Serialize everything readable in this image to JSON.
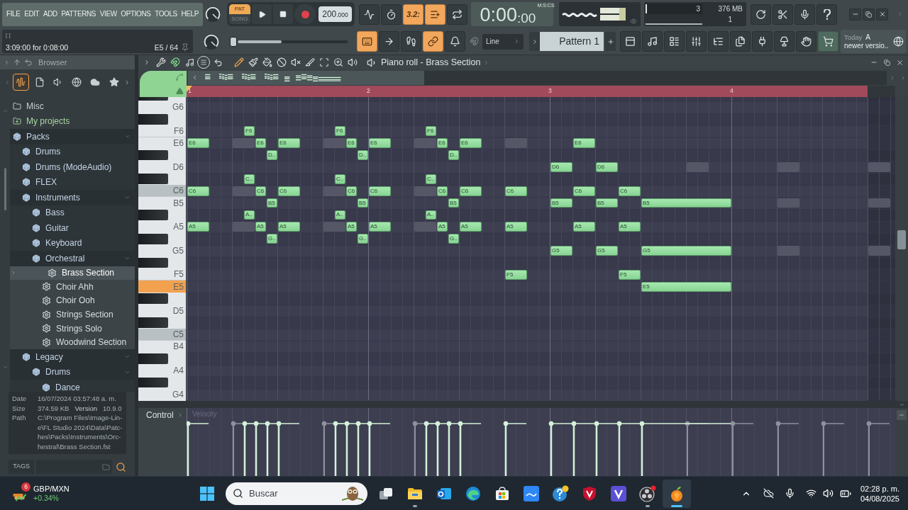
{
  "menu": {
    "items": [
      "FILE",
      "EDIT",
      "ADD",
      "PATTERNS",
      "VIEW",
      "OPTIONS",
      "TOOLS",
      "HELP"
    ]
  },
  "hint": {
    "title": "[ ]",
    "text": "3:09:00 for 0:08:00",
    "note": "E5 / 64"
  },
  "transport": {
    "modes": [
      {
        "label": "PAT",
        "selected": true
      },
      {
        "label": "SONG",
        "selected": false
      }
    ],
    "tempo_whole": "200",
    "tempo_fraction": ".000",
    "position": {
      "level": 0
    }
  },
  "record_toggles": [
    {
      "on": false
    },
    {
      "on": false
    },
    {
      "label": "3.2:",
      "on": true
    },
    {
      "on": true
    },
    {
      "on": false
    }
  ],
  "edit_toggles": [
    {
      "on": true
    },
    {
      "on": false
    },
    {
      "on": false
    },
    {
      "on": true
    },
    {
      "on": false
    }
  ],
  "time": {
    "main": "0:00",
    "fraction": ":00",
    "unit": "M:S:CS"
  },
  "meters": {
    "cpu": {
      "level": 0.03
    },
    "top_value": "3",
    "memory": "376 MB",
    "bottom_value": "1"
  },
  "snap": {
    "value": "Line"
  },
  "pattern": {
    "name": "Pattern 1"
  },
  "news": {
    "date": "Today",
    "lines": [
      "A",
      "newer versio.."
    ]
  },
  "browser": {
    "title": "Browser",
    "tabs": [
      {
        "selected": true
      },
      {
        "selected": false
      },
      {
        "selected": false
      },
      {
        "selected": false
      },
      {
        "selected": false
      },
      {
        "selected": false
      }
    ],
    "tree": [
      {
        "label": "Misc",
        "kind": "folder",
        "expanded": false,
        "selected": false
      },
      {
        "label": "My projects",
        "kind": "projects",
        "expanded": false,
        "selected": false
      },
      {
        "label": "Packs",
        "kind": "pack",
        "expanded": true,
        "selected": false,
        "children": [
          {
            "label": "Drums",
            "kind": "pack",
            "expanded": false,
            "selected": false
          },
          {
            "label": "Drums (ModeAudio)",
            "kind": "pack",
            "expanded": false,
            "selected": false
          },
          {
            "label": "FLEX",
            "kind": "pack",
            "expanded": false,
            "selected": false
          },
          {
            "label": "Instruments",
            "kind": "pack",
            "expanded": true,
            "selected": false,
            "children": [
              {
                "label": "Bass",
                "kind": "pack",
                "expanded": false,
                "selected": false
              },
              {
                "label": "Guitar",
                "kind": "pack",
                "expanded": false,
                "selected": false
              },
              {
                "label": "Keyboard",
                "kind": "pack",
                "expanded": false,
                "selected": false
              },
              {
                "label": "Orchestral",
                "kind": "pack",
                "expanded": true,
                "selected": false,
                "children": [
                  {
                    "label": "Brass Section",
                    "kind": "preset",
                    "selected": true
                  },
                  {
                    "label": "Choir Ahh",
                    "kind": "preset",
                    "selected": false
                  },
                  {
                    "label": "Choir Ooh",
                    "kind": "preset",
                    "selected": false
                  },
                  {
                    "label": "Strings Section",
                    "kind": "preset",
                    "selected": false
                  },
                  {
                    "label": "Strings Solo",
                    "kind": "preset",
                    "selected": false
                  },
                  {
                    "label": "Woodwind Section",
                    "kind": "preset",
                    "selected": false
                  }
                ]
              }
            ]
          },
          {
            "label": "Legacy",
            "kind": "pack",
            "expanded": true,
            "selected": false,
            "children": [
              {
                "label": "Drums",
                "kind": "pack",
                "expanded": true,
                "selected": false,
                "children": [
                  {
                    "label": "Dance",
                    "kind": "pack",
                    "expanded": false,
                    "selected": false
                  }
                ]
              }
            ]
          }
        ]
      }
    ],
    "info": {
      "date_label": "Date",
      "date": "16/07/2024 03:57:48 a. m.",
      "size_label": "Size",
      "size": "374.59 KB",
      "version_label": "Version",
      "version": "10.9.0",
      "path_label": "Path",
      "path_lines": [
        "C:\\Program Files\\Image-Lin-",
        "e\\FL Studio 2024\\Data\\Patc-",
        "hes\\Packs\\Instruments\\Orc-",
        "hestral\\Brass Section.fst"
      ]
    },
    "tags": {
      "label": "TAGS"
    }
  },
  "piano_roll": {
    "title": "Piano roll - Brass Section",
    "snap": true,
    "tools": [
      {
        "selected": true
      },
      {
        "selected": false
      },
      {
        "selected": false
      },
      {
        "selected": false
      },
      {
        "selected": false
      },
      {
        "selected": false
      },
      {
        "selected": false
      },
      {
        "selected": false
      },
      {
        "selected": false
      }
    ],
    "bars": [
      "1",
      "2",
      "3",
      "4"
    ],
    "rows": [
      {
        "kind": "sharp",
        "selected": false
      },
      {
        "kind": "natural",
        "label": "G6",
        "selected": false
      },
      {
        "kind": "sharp",
        "selected": false
      },
      {
        "kind": "natural",
        "label": "F6",
        "selected": false,
        "notes": [
          "F6",
          "F6",
          "F6"
        ]
      },
      {
        "kind": "natural",
        "label": "E6",
        "selected": false,
        "notes": [
          "E6",
          "E6",
          "E6",
          "E6",
          "E6",
          "E6",
          "E6",
          "E6"
        ]
      },
      {
        "kind": "sharp",
        "selected": false,
        "notes": [
          "D..",
          "D..",
          "D.."
        ]
      },
      {
        "kind": "natural",
        "label": "D6",
        "selected": false,
        "notes": [
          "D6",
          "D6"
        ]
      },
      {
        "kind": "sharp",
        "selected": false,
        "notes": [
          "C..",
          "C..",
          "C.."
        ]
      },
      {
        "kind": "c",
        "label": "C6",
        "selected": false,
        "notes": [
          "C6",
          "C6",
          "C6",
          "C6",
          "C6",
          "C6",
          "C6",
          "C6",
          "C6",
          "C6"
        ]
      },
      {
        "kind": "natural",
        "label": "B5",
        "selected": false,
        "notes": [
          "B5",
          "B5",
          "B5",
          "B5",
          "B5",
          "B5"
        ]
      },
      {
        "kind": "sharp",
        "selected": false,
        "notes": [
          "A..",
          "A..",
          "A.."
        ]
      },
      {
        "kind": "natural",
        "label": "A5",
        "selected": false,
        "notes": [
          "A5",
          "A5",
          "A5",
          "A5",
          "A5",
          "A5",
          "A5",
          "A5",
          "A5",
          "A5"
        ]
      },
      {
        "kind": "sharp",
        "selected": false,
        "notes": [
          "G..",
          "G..",
          "G.."
        ]
      },
      {
        "kind": "natural",
        "label": "G5",
        "selected": false,
        "notes": [
          "G5",
          "G5",
          "G5"
        ]
      },
      {
        "kind": "sharp",
        "selected": false
      },
      {
        "kind": "natural",
        "label": "F5",
        "selected": false,
        "notes": [
          "F5",
          "F5"
        ]
      },
      {
        "kind": "natural",
        "label": "E5",
        "selected": true,
        "notes": [
          "E5"
        ]
      },
      {
        "kind": "sharp",
        "selected": false
      },
      {
        "kind": "natural",
        "label": "D5",
        "selected": false
      },
      {
        "kind": "sharp",
        "selected": false
      },
      {
        "kind": "c",
        "label": "C5",
        "selected": false
      },
      {
        "kind": "natural",
        "label": "B4",
        "selected": false
      },
      {
        "kind": "sharp",
        "selected": false
      },
      {
        "kind": "natural",
        "label": "A4",
        "selected": false
      },
      {
        "kind": "sharp",
        "selected": false
      },
      {
        "kind": "natural",
        "label": "G4",
        "selected": false
      }
    ],
    "control": "Control",
    "lane": "Velocity"
  },
  "taskbar": {
    "widget": {
      "badge": "6",
      "title": "GBP/MXN",
      "change": "+0.34%"
    },
    "search": {
      "placeholder": "Buscar"
    },
    "apps": [
      {
        "running": false,
        "active": false
      },
      {
        "running": true,
        "active": false
      },
      {
        "running": false,
        "active": false
      },
      {
        "running": false,
        "active": false
      },
      {
        "running": false,
        "active": false
      },
      {
        "running": false,
        "active": false
      },
      {
        "running": false,
        "active": false
      },
      {
        "running": false,
        "active": false
      },
      {
        "running": false,
        "active": false
      },
      {
        "running": true,
        "active": false
      },
      {
        "running": true,
        "active": true
      }
    ],
    "clock": {
      "time": "02:28 p. m.",
      "date": "04/08/2025"
    }
  }
}
